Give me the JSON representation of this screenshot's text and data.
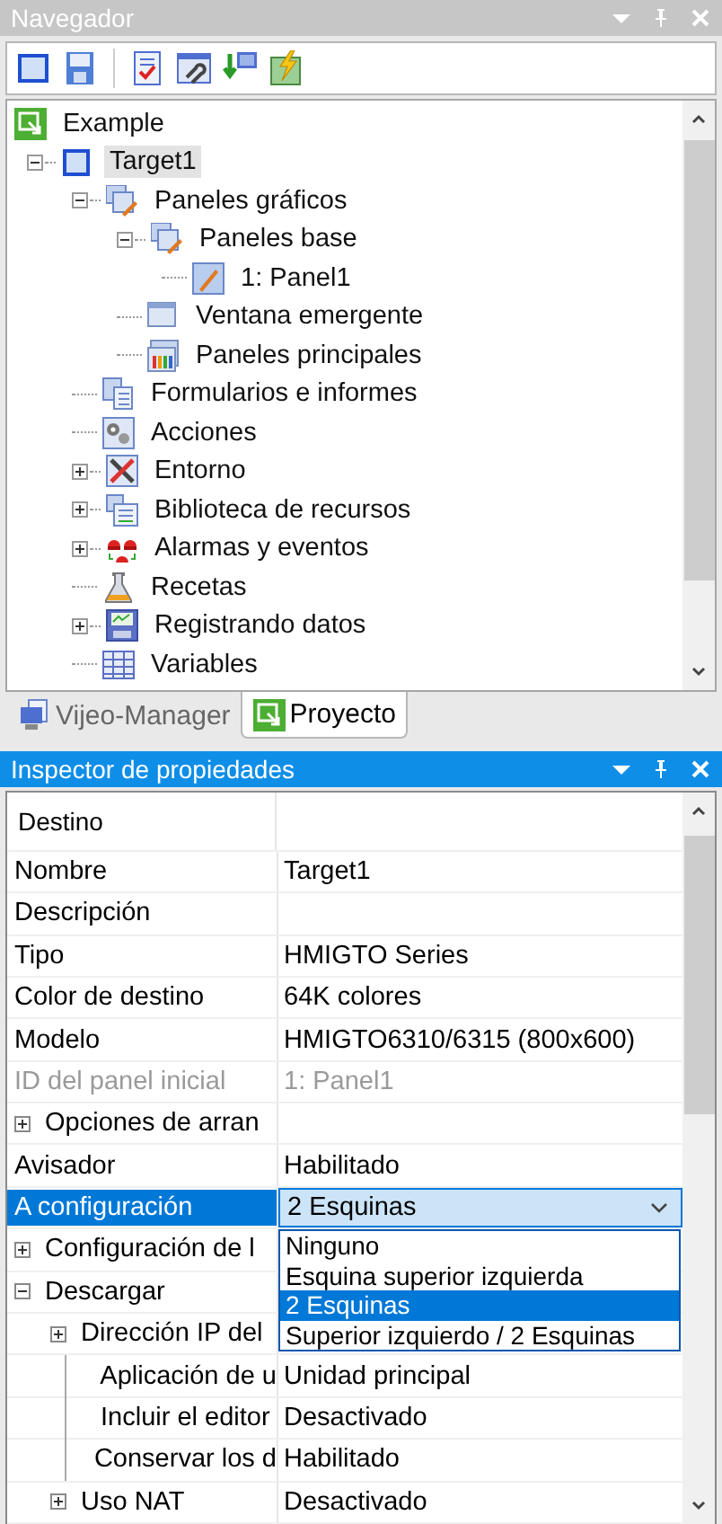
{
  "navigator": {
    "title": "Navegador",
    "active": false,
    "tree": [
      {
        "label": "Example",
        "selected": false,
        "children": [
          {
            "label": "Target1",
            "selected": true,
            "expanded": true,
            "children": [
              {
                "label": "Paneles gráficos",
                "selected": false,
                "expanded": true,
                "children": [
                  {
                    "label": "Paneles base",
                    "selected": false,
                    "expanded": true,
                    "children": [
                      {
                        "label": "1: Panel1",
                        "selected": false
                      }
                    ]
                  },
                  {
                    "label": "Ventana emergente",
                    "selected": false
                  },
                  {
                    "label": "Paneles principales",
                    "selected": false
                  }
                ]
              },
              {
                "label": "Formularios e informes",
                "selected": false
              },
              {
                "label": "Acciones",
                "selected": false
              },
              {
                "label": "Entorno",
                "selected": false,
                "expanded": false
              },
              {
                "label": "Biblioteca de recursos",
                "selected": false,
                "expanded": false
              },
              {
                "label": "Alarmas y eventos",
                "selected": false,
                "expanded": false
              },
              {
                "label": "Recetas",
                "selected": false
              },
              {
                "label": "Registrando datos",
                "selected": false,
                "expanded": false
              },
              {
                "label": "Variables",
                "selected": false
              }
            ]
          }
        ]
      }
    ],
    "tabs": [
      {
        "label": "Vijeo-Manager",
        "selected": false
      },
      {
        "label": "Proyecto",
        "selected": true
      }
    ]
  },
  "inspector": {
    "title": "Inspector de propiedades",
    "active": true,
    "rows": [
      {
        "kind": "category",
        "label": "Destino"
      },
      {
        "kind": "property",
        "label": "Nombre",
        "value": "Target1",
        "selected": false,
        "disabled": false
      },
      {
        "kind": "property",
        "label": "Descripción",
        "selected": false,
        "disabled": false
      },
      {
        "kind": "property",
        "label": "Tipo",
        "value": "HMIGTO Series",
        "selected": false,
        "disabled": false
      },
      {
        "kind": "property",
        "label": "Color de destino",
        "value": "64K colores",
        "selected": false,
        "disabled": false
      },
      {
        "kind": "property",
        "label": "Modelo",
        "value": "HMIGTO6310/6315 (800x600)",
        "selected": false,
        "disabled": false
      },
      {
        "kind": "property",
        "label": "ID del panel inicial",
        "value": "1: Panel1",
        "selected": false,
        "disabled": true
      },
      {
        "kind": "group",
        "label": "Opciones  de arran",
        "expanded": false,
        "selected": false
      },
      {
        "kind": "property",
        "label": "Avisador",
        "value": "Habilitado",
        "selected": false,
        "disabled": false
      },
      {
        "kind": "dropdown",
        "label": "A configuración",
        "value": "2 Esquinas",
        "selected": true,
        "open": true,
        "options": [
          {
            "label": "Ninguno",
            "selected": false
          },
          {
            "label": "Esquina superior izquierda",
            "selected": false
          },
          {
            "label": "2 Esquinas",
            "selected": true
          },
          {
            "label": "Superior izquierdo / 2 Esquinas",
            "selected": false
          }
        ]
      },
      {
        "kind": "group",
        "label": "Configuración de l",
        "expanded": false,
        "selected": false
      },
      {
        "kind": "group",
        "label": "Descargar",
        "expanded": true,
        "selected": false,
        "children": [
          {
            "kind": "group",
            "label": "Dirección IP del",
            "expanded": false,
            "selected": false
          },
          {
            "kind": "property",
            "label": "Aplicación de u",
            "value": "Unidad principal",
            "selected": false,
            "disabled": false
          },
          {
            "kind": "property",
            "label": "Incluir el editor",
            "value": "Desactivado",
            "selected": false,
            "disabled": false
          },
          {
            "kind": "property",
            "label": "Conservar los d",
            "value": "Habilitado",
            "selected": false,
            "disabled": false
          },
          {
            "kind": "group",
            "label": "Uso NAT",
            "value": "Desactivado",
            "expanded": false,
            "selected": false
          }
        ]
      }
    ]
  }
}
